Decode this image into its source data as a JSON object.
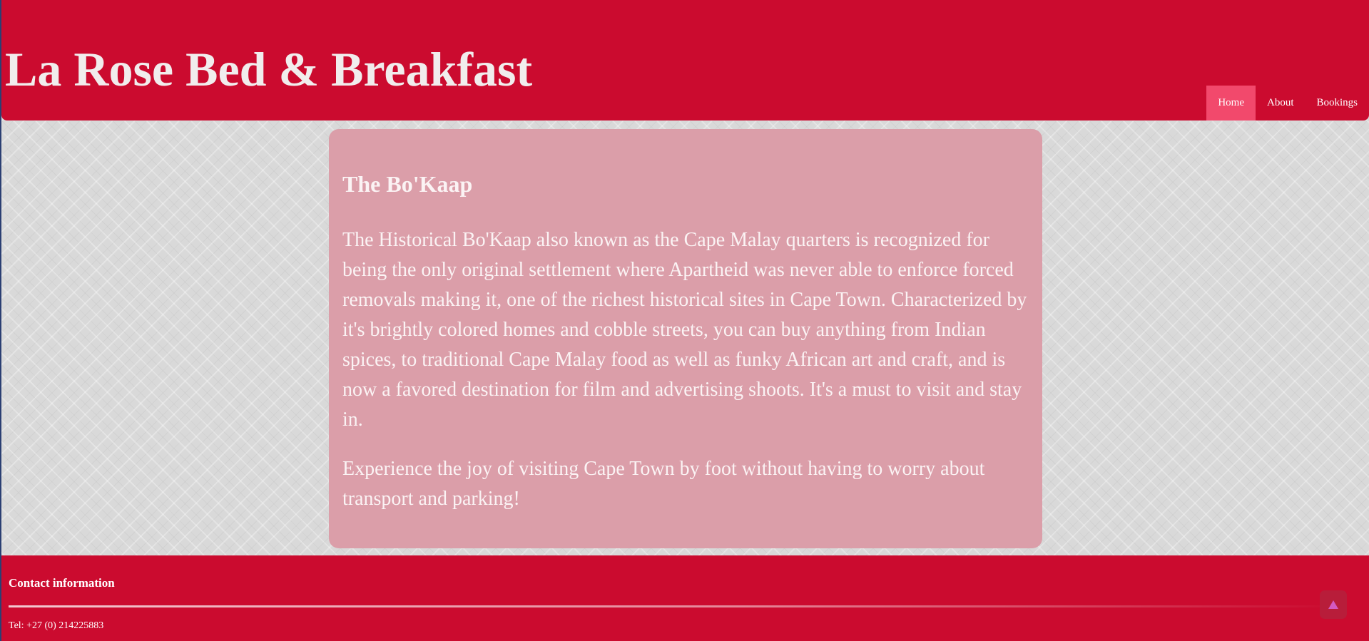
{
  "header": {
    "title": "La Rose Bed & Breakfast",
    "nav": [
      {
        "label": "Home",
        "active": true
      },
      {
        "label": "About",
        "active": false
      },
      {
        "label": "Bookings",
        "active": false
      }
    ]
  },
  "main": {
    "heading": "The Bo'Kaap",
    "paragraphs": [
      "The Historical Bo'Kaap also known as the Cape Malay quarters is recognized for being the only original settlement where Apartheid was never able to enforce forced removals making it, one of the richest historical sites in Cape Town. Characterized by it's brightly colored homes and cobble streets, you can buy anything from Indian spices, to traditional Cape Malay food as well as funky African art and craft, and is now a favored destination for film and advertising shoots. It's a must to visit and stay in.",
      "Experience the joy of visiting Cape Town by foot without having to worry about transport and parking!"
    ]
  },
  "footer": {
    "heading": "Contact information",
    "tel": "Tel: +27 (0) 214225883"
  },
  "back_to_top": {
    "icon": "triangle-up-icon"
  },
  "colors": {
    "brand_red": "#cb0b2f",
    "nav_active": "#f2496c",
    "card_pink": "#db9ea9"
  }
}
